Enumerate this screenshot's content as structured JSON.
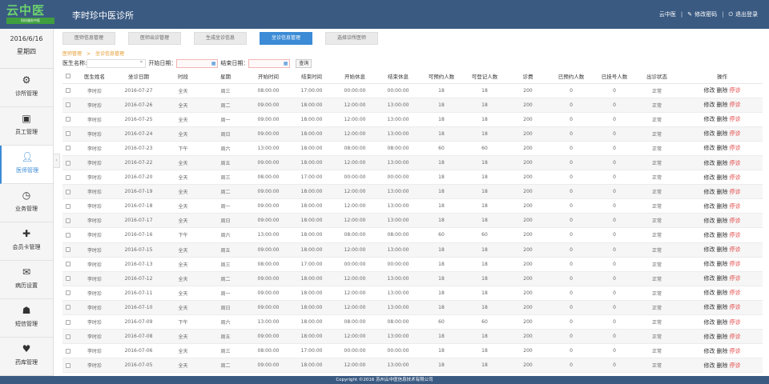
{
  "header": {
    "logo_text": "云中医",
    "logo_sub": "科技服务中医",
    "app_title": "李时珍中医诊所",
    "user": "云中医",
    "change_password": "修改密码",
    "logout": "退出登录"
  },
  "sidebar": {
    "date": "2016/6/16",
    "weekday": "星期四",
    "items": [
      {
        "label": "诊所管理",
        "icon": "gear-icon"
      },
      {
        "label": "员工管理",
        "icon": "id-card-icon"
      },
      {
        "label": "医师管理",
        "icon": "user-icon"
      },
      {
        "label": "业务管理",
        "icon": "clock-icon"
      },
      {
        "label": "会员卡管理",
        "icon": "medical-card-icon"
      },
      {
        "label": "病历设置",
        "icon": "envelope-icon"
      },
      {
        "label": "短信管理",
        "icon": "person-message-icon"
      },
      {
        "label": "药库管理",
        "icon": "heart-pill-icon"
      }
    ]
  },
  "tabs": [
    "医师信息管理",
    "医师出诊管理",
    "生成坐诊信息",
    "坐诊信息管理",
    "选择诊所医师"
  ],
  "breadcrumb": {
    "parent": "医师管理",
    "current": "坐诊信息管理"
  },
  "search": {
    "doctor_label": "医生名称:",
    "start_label": "开始日期：",
    "end_label": "结束日期：",
    "query_button": "查询"
  },
  "table": {
    "headers": [
      "医生姓名",
      "坐诊日期",
      "时段",
      "星期",
      "开始时间",
      "结束时间",
      "开始休息",
      "结束休息",
      "可预约人数",
      "可登记人数",
      "诊费",
      "已预约人数",
      "已挂号人数",
      "出诊状态",
      "操作"
    ],
    "op_edit": "修改",
    "op_delete": "删除",
    "op_stop": "停诊",
    "rows": [
      [
        "李时珍",
        "2016-07-27",
        "全天",
        "周三",
        "08:00:00",
        "17:00:00",
        "00:00:00",
        "00:00:00",
        "18",
        "18",
        "200",
        "0",
        "0",
        "正常"
      ],
      [
        "李时珍",
        "2016-07-26",
        "全天",
        "周二",
        "09:00:00",
        "18:00:00",
        "12:00:00",
        "13:00:00",
        "18",
        "18",
        "200",
        "0",
        "0",
        "正常"
      ],
      [
        "李时珍",
        "2016-07-25",
        "全天",
        "周一",
        "09:00:00",
        "18:00:00",
        "12:00:00",
        "13:00:00",
        "18",
        "18",
        "200",
        "0",
        "0",
        "正常"
      ],
      [
        "李时珍",
        "2016-07-24",
        "全天",
        "周日",
        "09:00:00",
        "18:00:00",
        "12:00:00",
        "13:00:00",
        "18",
        "18",
        "200",
        "0",
        "0",
        "正常"
      ],
      [
        "李时珍",
        "2016-07-23",
        "下午",
        "周六",
        "13:00:00",
        "18:00:00",
        "08:00:00",
        "08:00:00",
        "60",
        "60",
        "200",
        "0",
        "0",
        "正常"
      ],
      [
        "李时珍",
        "2016-07-22",
        "全天",
        "周五",
        "09:00:00",
        "18:00:00",
        "12:00:00",
        "13:00:00",
        "18",
        "18",
        "200",
        "0",
        "0",
        "正常"
      ],
      [
        "李时珍",
        "2016-07-20",
        "全天",
        "周三",
        "08:00:00",
        "17:00:00",
        "00:00:00",
        "00:00:00",
        "18",
        "18",
        "200",
        "0",
        "0",
        "正常"
      ],
      [
        "李时珍",
        "2016-07-19",
        "全天",
        "周二",
        "09:00:00",
        "18:00:00",
        "12:00:00",
        "13:00:00",
        "18",
        "18",
        "200",
        "0",
        "0",
        "正常"
      ],
      [
        "李时珍",
        "2016-07-18",
        "全天",
        "周一",
        "09:00:00",
        "18:00:00",
        "12:00:00",
        "13:00:00",
        "18",
        "18",
        "200",
        "0",
        "0",
        "正常"
      ],
      [
        "李时珍",
        "2016-07-17",
        "全天",
        "周日",
        "09:00:00",
        "18:00:00",
        "12:00:00",
        "13:00:00",
        "18",
        "18",
        "200",
        "0",
        "0",
        "正常"
      ],
      [
        "李时珍",
        "2016-07-16",
        "下午",
        "周六",
        "13:00:00",
        "18:00:00",
        "08:00:00",
        "08:00:00",
        "60",
        "60",
        "200",
        "0",
        "0",
        "正常"
      ],
      [
        "李时珍",
        "2016-07-15",
        "全天",
        "周五",
        "09:00:00",
        "18:00:00",
        "12:00:00",
        "13:00:00",
        "18",
        "18",
        "200",
        "0",
        "0",
        "正常"
      ],
      [
        "李时珍",
        "2016-07-13",
        "全天",
        "周三",
        "08:00:00",
        "17:00:00",
        "00:00:00",
        "00:00:00",
        "18",
        "18",
        "200",
        "0",
        "0",
        "正常"
      ],
      [
        "李时珍",
        "2016-07-12",
        "全天",
        "周二",
        "09:00:00",
        "18:00:00",
        "12:00:00",
        "13:00:00",
        "18",
        "18",
        "200",
        "0",
        "0",
        "正常"
      ],
      [
        "李时珍",
        "2016-07-11",
        "全天",
        "周一",
        "09:00:00",
        "18:00:00",
        "12:00:00",
        "13:00:00",
        "18",
        "18",
        "200",
        "0",
        "0",
        "正常"
      ],
      [
        "李时珍",
        "2016-07-10",
        "全天",
        "周日",
        "09:00:00",
        "18:00:00",
        "12:00:00",
        "13:00:00",
        "18",
        "18",
        "200",
        "0",
        "0",
        "正常"
      ],
      [
        "李时珍",
        "2016-07-09",
        "下午",
        "周六",
        "13:00:00",
        "18:00:00",
        "08:00:00",
        "08:00:00",
        "60",
        "60",
        "200",
        "0",
        "0",
        "正常"
      ],
      [
        "李时珍",
        "2016-07-08",
        "全天",
        "周五",
        "09:00:00",
        "18:00:00",
        "12:00:00",
        "13:00:00",
        "18",
        "18",
        "200",
        "0",
        "0",
        "正常"
      ],
      [
        "李时珍",
        "2016-07-06",
        "全天",
        "周三",
        "08:00:00",
        "17:00:00",
        "00:00:00",
        "00:00:00",
        "18",
        "18",
        "200",
        "0",
        "0",
        "正常"
      ],
      [
        "李时珍",
        "2016-07-05",
        "全天",
        "周二",
        "09:00:00",
        "18:00:00",
        "12:00:00",
        "13:00:00",
        "18",
        "18",
        "200",
        "0",
        "0",
        "正常"
      ]
    ]
  },
  "footer": "Copyright ©2016 苏州云中医信息技术有限公司",
  "colors": {
    "header": "#3a5a82",
    "accent": "#3b8bd6",
    "breadcrumb": "#e49b2d",
    "stop": "#e23b3b"
  }
}
